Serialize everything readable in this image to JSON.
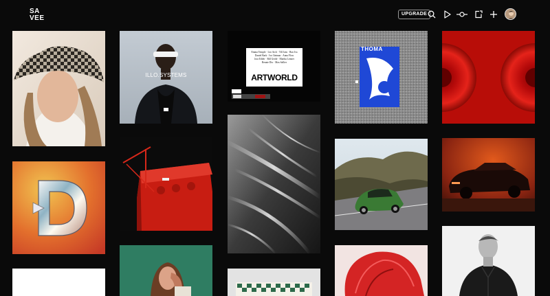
{
  "header": {
    "logo_line1": "SA",
    "logo_line2": "VEE",
    "upgrade_label": "UPGRADE",
    "icons": [
      "search-icon",
      "play-icon",
      "commit-icon",
      "share-icon",
      "plus-icon"
    ],
    "avatar_icon": "user-avatar"
  },
  "tiles": {
    "illo_systems": {
      "title": "ILLO.SYSTEMS"
    },
    "artworld": {
      "title": "ARTWORLD",
      "names": [
        "Emma Temple · Leo Arch · Till Jans · Bon Iva",
        "Daniel Bark · Ivo Oatman · Anna Flow",
        "Jora Edder · Bill Gerde · Martha Lenner",
        "Renate Dix · Max Sallier"
      ]
    },
    "thomas": {
      "title": "THOMA"
    }
  }
}
